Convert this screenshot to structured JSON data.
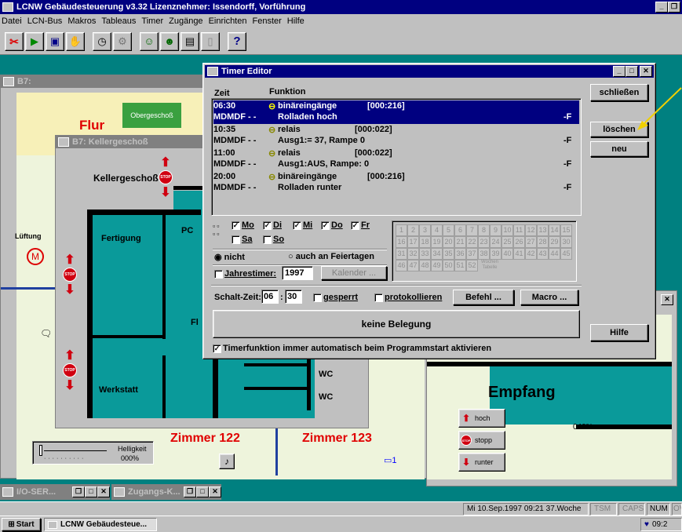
{
  "app": {
    "title": "LCNW Gebäudesteuerung v3.32    Lizenznehmer: Issendorff, Vorführung"
  },
  "menu": [
    "Datei",
    "LCN-Bus",
    "Makros",
    "Tableaus",
    "Timer",
    "Zugänge",
    "Einrichten",
    "Fenster",
    "Hilfe"
  ],
  "tableau": {
    "title": "B7:",
    "flur": "Flur",
    "obergeschoss": "Obergeschoß",
    "lueftung": "Lüftung",
    "zimmer122": "Zimmer 122",
    "zimmer123": "Zimmer 123",
    "helligkeit_label": "Helligkeit",
    "helligkeit_value": "000%",
    "count123": "1"
  },
  "keller": {
    "title": "B7: Kellergeschoß",
    "label": "Kellergeschoß",
    "fertigung": "Fertigung",
    "pc": "PC",
    "fl": "Fl",
    "werkstatt": "Werkstatt",
    "wc1": "WC",
    "wc2": "WC"
  },
  "empfang": {
    "label": "Empfang",
    "hoch": "hoch",
    "stopp": "stopp",
    "runter": "runter",
    "percent": "040%"
  },
  "timer": {
    "title": "Timer Editor",
    "col_zeit": "Zeit",
    "col_funktion": "Funktion",
    "entries": [
      {
        "time": "06:30",
        "days": "MDMDF - -",
        "func": "binäreingänge",
        "addr": "[000:216]",
        "sub": "Rolladen hoch",
        "flag": "-F",
        "selected": true
      },
      {
        "time": "10:35",
        "days": "MDMDF - -",
        "func": "relais",
        "addr": "[000:022]",
        "sub": "Ausg1:= 37, Rampe 0",
        "flag": "-F",
        "selected": false
      },
      {
        "time": "11:00",
        "days": "MDMDF - -",
        "func": "relais",
        "addr": "[000:022]",
        "sub": "Ausg1:AUS, Rampe:  0",
        "flag": "-F",
        "selected": false
      },
      {
        "time": "20:00",
        "days": "MDMDF - -",
        "func": "binäreingänge",
        "addr": "[000:216]",
        "sub": "Rolladen runter",
        "flag": "-F",
        "selected": false
      }
    ],
    "days": [
      {
        "label": "Mo",
        "checked": true
      },
      {
        "label": "Di",
        "checked": true
      },
      {
        "label": "Mi",
        "checked": true
      },
      {
        "label": "Do",
        "checked": true
      },
      {
        "label": "Fr",
        "checked": true
      },
      {
        "label": "Sa",
        "checked": false
      },
      {
        "label": "So",
        "checked": false
      }
    ],
    "radio_nicht": "nicht",
    "radio_feiertag": "auch an Feiertagen",
    "jahrestimer": "Jahrestimer:",
    "year": "1997",
    "kalender": "Kalender ...",
    "weeks": [
      "1",
      "2",
      "3",
      "4",
      "5",
      "6",
      "7",
      "8",
      "9",
      "10",
      "11",
      "12",
      "13",
      "14",
      "15",
      "16",
      "17",
      "18",
      "19",
      "20",
      "21",
      "22",
      "23",
      "24",
      "25",
      "26",
      "27",
      "28",
      "29",
      "30",
      "31",
      "32",
      "33",
      "34",
      "35",
      "36",
      "37",
      "38",
      "39",
      "40",
      "41",
      "42",
      "43",
      "44",
      "45",
      "46",
      "47",
      "48",
      "49",
      "50",
      "51",
      "52"
    ],
    "wochen_tabelle": "Wochen Tabelle",
    "schaltzeit_label": "Schalt-Zeit:",
    "hour": "06",
    "minute": "30",
    "gesperrt": "gesperrt",
    "protokollieren": "protokollieren",
    "befehl": "Befehl ...",
    "macro": "Macro ...",
    "belegung": "keine Belegung",
    "autostart": "Timerfunktion immer automatisch beim Programmstart aktivieren",
    "schliessen": "schließen",
    "loeschen": "löschen",
    "neu": "neu",
    "hilfe": "Hilfe"
  },
  "minimized": [
    {
      "title": "I/O-SER..."
    },
    {
      "title": "Zugangs-K..."
    }
  ],
  "status": {
    "datetime": "Mi 10.Sep.1997  09:21  37.Woche",
    "tsm": "TSM",
    "caps": "CAPS",
    "num": "NUM",
    "ov": "OV"
  },
  "taskbar": {
    "start": "Start",
    "task": "LCNW Gebäudesteue...",
    "clock": "09:2"
  }
}
